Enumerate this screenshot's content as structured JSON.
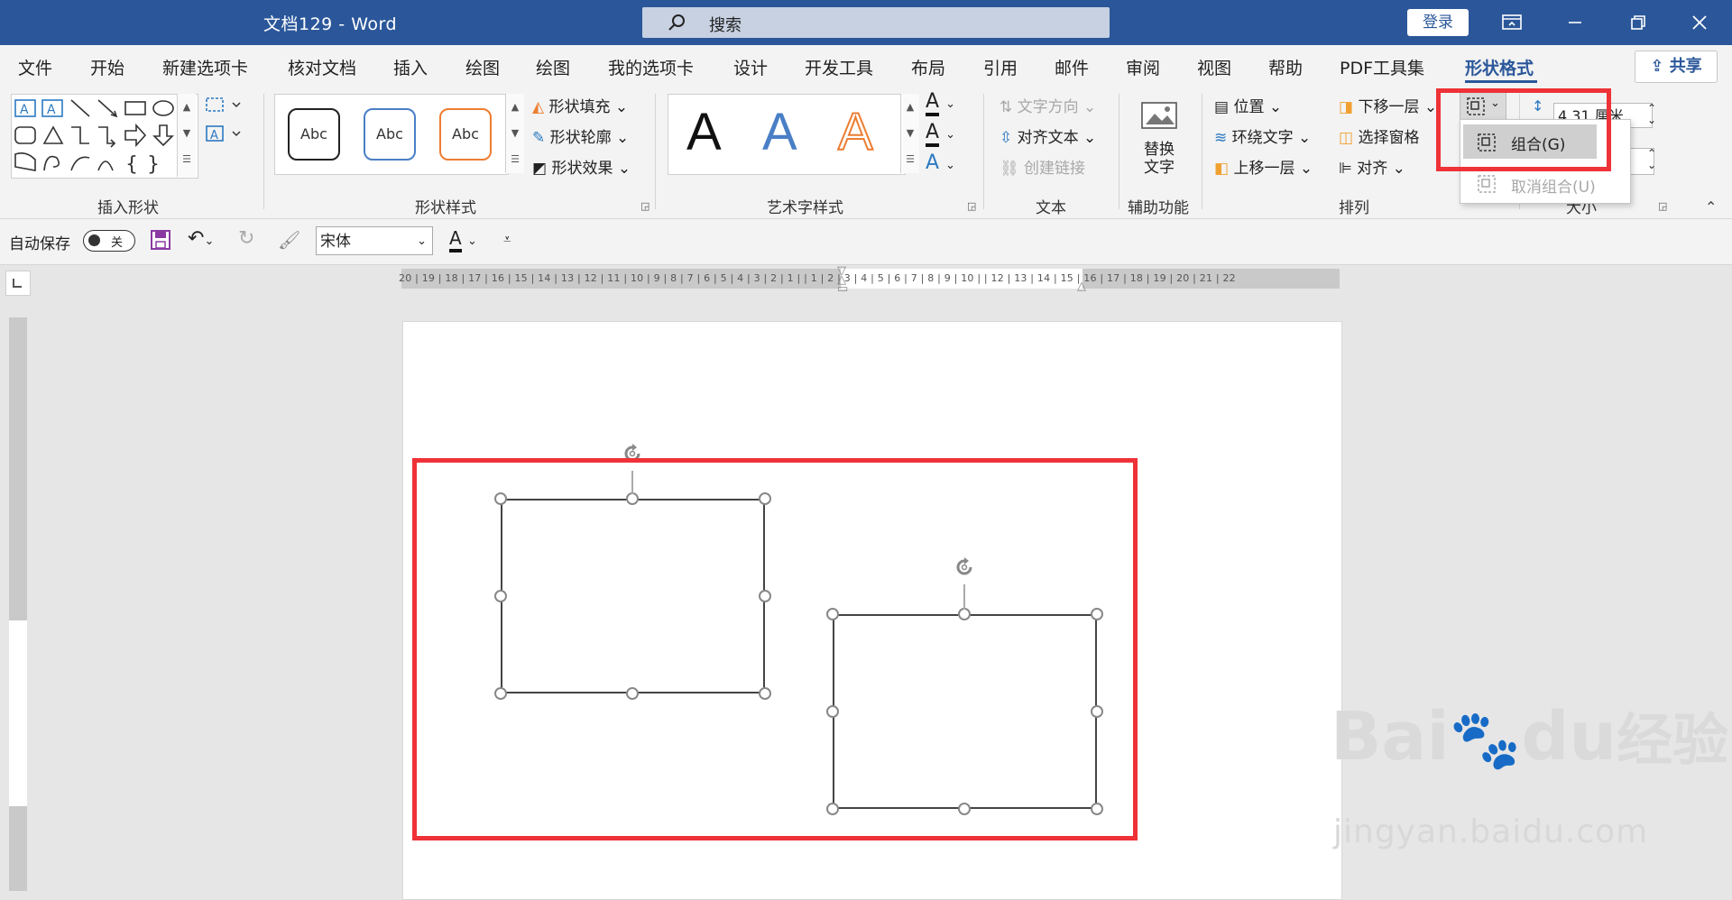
{
  "titlebar": {
    "doc_title": "文档129  -  Word",
    "search_placeholder": "搜索",
    "login_label": "登录",
    "bg_color": "#2b579a"
  },
  "tabs": [
    "文件",
    "开始",
    "新建选项卡",
    "核对文档",
    "插入",
    "绘图",
    "绘图",
    "我的选项卡",
    "设计",
    "开发工具",
    "布局",
    "引用",
    "邮件",
    "审阅",
    "视图",
    "帮助",
    "PDF工具集",
    "形状格式"
  ],
  "active_tab": "形状格式",
  "share_label": "共享",
  "ribbon": {
    "groups": {
      "insert_shapes": "插入形状",
      "shape_styles": "形状样式",
      "wordart_styles": "艺术字样式",
      "text": "文本",
      "accessibility": "辅助功能",
      "arrange": "排列",
      "size": "大小"
    },
    "shape_style_samples": [
      "Abc",
      "Abc",
      "Abc"
    ],
    "shape_fill": "形状填充",
    "shape_outline": "形状轮廓",
    "shape_effects": "形状效果",
    "wordart_samples": [
      "A",
      "A",
      "A"
    ],
    "text_direction": "文字方向",
    "align_text": "对齐文本",
    "create_link": "创建链接",
    "alt_text_line1": "替换",
    "alt_text_line2": "文字",
    "position": "位置",
    "wrap_text": "环绕文字",
    "bring_forward": "上移一层",
    "send_backward": "下移一层",
    "selection_pane": "选择窗格",
    "align": "对齐",
    "height_value": "4.31 厘米"
  },
  "group_dropdown": {
    "group_label": "组合(G)",
    "ungroup_label": "取消组合(U)"
  },
  "qat": {
    "autosave_label": "自动保存",
    "autosave_state": "关",
    "font_name": "宋体"
  },
  "ruler": {
    "horizontal": "20 | 19 | 18 | 17 | 16 | 15 | 14 | 13 | 12 | 11 | 10 | 9 | 8 | 7 | 6 | 5 | 4 | 3 | 2 | 1 |  | 1 | 2 | 3 | 4 | 5 | 6 | 7 | 8 | 9 | 10 |  | 12 | 13 | 14 | 15 | 16 | 17 | 18 | 19 | 20 | 21 | 22"
  },
  "watermark": {
    "brand": "Bai",
    "brand2": "du",
    "brand3": "经验",
    "url": "jingyan.baidu.com"
  }
}
